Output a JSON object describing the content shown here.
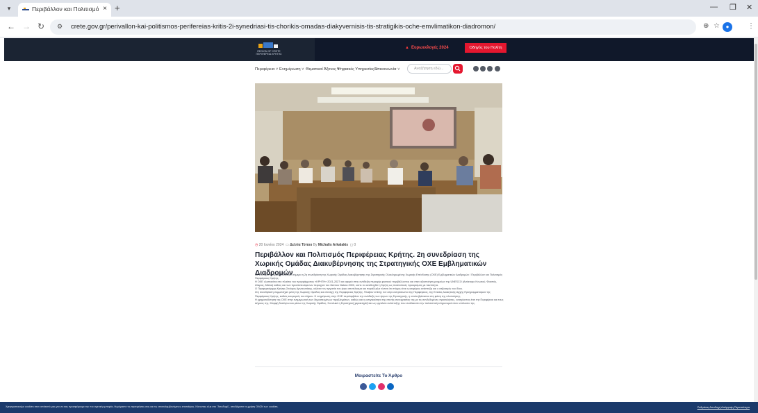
{
  "browser": {
    "tab_title": "Περιβάλλον και Πολιτισμός Πε",
    "tab_close": "×",
    "new_tab": "+",
    "url": "crete.gov.gr/perivallon-kai-politismos-perifereias-kritis-2i-synedriasi-tis-chorikis-omadas-diakyvernisis-tis-stratigikis-oche-emvlimatikon-diadromon/"
  },
  "header": {
    "logo_text": "REGION OF CRETE ΠΕΡΙΦΕΡΕΙΑ ΚΡΗΤΗΣ",
    "eu_link": "Ευρωεκλογές 2024",
    "guide_button": "Οδηγός του Πολίτη"
  },
  "nav": {
    "items": [
      "Περιφέρεια",
      "Ενημέρωση",
      "Θεματικοί Άξονες",
      "Ψηφιακές Υπηρεσίες",
      "Επικοινωνία"
    ],
    "search_placeholder": "Αναζήτηση εδώ..."
  },
  "article": {
    "date": "20 Ιουνίου 2024",
    "category": "Δελτία Τύπου",
    "author_prefix": "By",
    "author": "Michalis Arkalakis",
    "comments": "0",
    "title": "Περιβάλλον και Πολιτισμός Περιφέρειας Κρήτης. 2η συνεδρίαση της Χωρικής Ομάδας Διακυβέρνησης της Στρατηγικής ΟΧΕ Εμβληματικών Διαδρομών",
    "paragraphs": [
      "Με επιτυχία πραγματοποιήθηκε σήμερα η 2η συνεδρίαση της Χωρικής Ομάδας Διακυβέρνησης της Στρατηγικής Ολοκληρωμένης Χωρικής Επένδυσης (ΟΧΕ) Εμβληματικών Διαδρομών / Περιβάλλον και Πολιτισμός Περιφέρειας Κρήτης.",
      "Η ΟΧΕ υλοποιείται στο πλαίσιο του προγράμματος «ΚΡΗΤΗ» 2021-2027 και αφορά στην ανάδειξη περιοχής φυσικού περιβάλλοντος και στην αξιοποίηση μνημείων της UNESCO (Ανάκτορο Κνωσού, Φαιστός, Ζάκρος, Μάλια) καθώς και των προστατευόμενων περιοχών του δικτύου Natura 2000, ώστε να αναδειχθεί η Κρήτη ως πολιτιστικός προορισμός με ταυτότητα.",
      "Ο Περιφερειάρχης Κρήτης Σταύρος Αρναουτάκης, κάλεσε τον εργασία του έργο αποτέλεσμα και παράλληλα τόνισε ότι στόχος είναι η αειφόρος ανάπτυξη και ο σεβασμός του ίδιου.",
      "Στη συνεδρίαση συμμετείχαν μέλη της Χωρικής Ομάδας και στελέχη της Περιφέρειας Κρήτης. Έλαβαν επίσης τον λόγο εκπρόσωποι της Περιφέρειας, της Ενιαίας Διοικητικής Αρχής Προγραμματισμού της Περιφέρειας Κρήτης, καθώς και φορείς του Δήμου. Η ενημέρωση στην ΟΧΕ περιλαμβάνει την ανάδειξη των έργων της Στρατηγικής, η οποία βρίσκεται στη φάση της υλοποίησης.",
      "Η χρηματοδότηση της ΟΧΕ στην ενημερωτική των δημοσιευμένων προβλημάτων, καθώς και η αναγκαιότητα της στενής συνεργασίας της με τις συνδεδεμένες προσκλήσεις, ενισχύοντας έτσι την Περιφέρεια και τους Δήμους της. Μορφή διαλόγου και μέσω της Χωρικής Ομάδας. Συνολικά η Στρατηγική χαρακτηρίζεται ως εργαλείο ανάπτυξης που αναδεικνύει την πολιτιστική κληρονομιά στον υπόλοιπο της."
    ],
    "share_title": "Μοιραστείτε Το Άρθρο"
  },
  "cookie": {
    "text": "Χρησιμοποιούμε cookies στον ιστότοπό μας για να σας προσφέρουμε την πιο σχετική εμπειρία, θυμόμαστε τις προτιμήσεις σας και τις επαναλαμβανόμενες επισκέψεις. Κάνοντας κλικ στο \"Αποδοχή\", αποδέχεστε τη χρήση ΟΛΩΝ των cookies.",
    "links": "Ρυθμίσεις  Αποδοχή  Απόρριψη  Περισσότερα"
  },
  "colors": {
    "header_bg": "#1b2433",
    "accent_red": "#e5172f",
    "cookie_bg": "#1b3a6b",
    "share_facebook": "#3b5998",
    "share_twitter": "#1da1f2",
    "share_pinterest": "#e1306c",
    "share_linkedin": "#0a66c2"
  },
  "icons": [
    "chevron-down-icon",
    "back-arrow-icon",
    "forward-arrow-icon",
    "reload-icon",
    "site-info-icon",
    "zoom-icon",
    "star-icon",
    "profile-icon",
    "menu-icon",
    "search-icon",
    "calendar-icon",
    "folder-icon",
    "comment-icon",
    "facebook-icon",
    "twitter-icon",
    "pinterest-icon",
    "linkedin-icon"
  ]
}
